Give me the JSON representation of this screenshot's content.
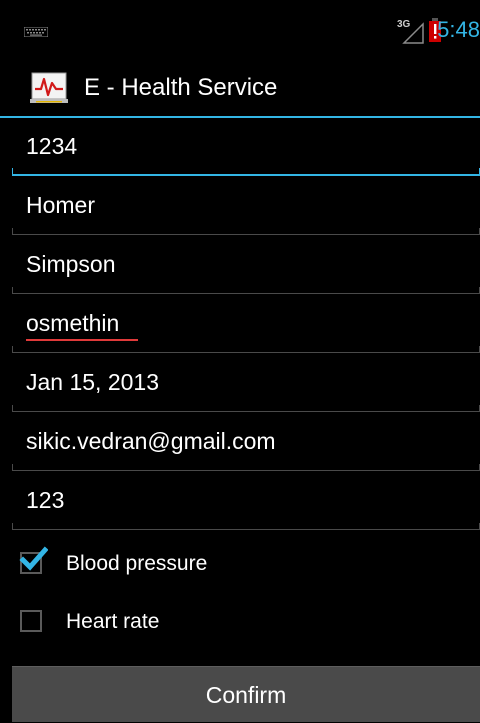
{
  "status_bar": {
    "network_label": "3G",
    "time": "5:48",
    "accent_color": "#33b5e5"
  },
  "action_bar": {
    "title": "E - Health Service",
    "icon": "heart-monitor-icon"
  },
  "form": {
    "fields": [
      {
        "value": "1234"
      },
      {
        "value": "Homer"
      },
      {
        "value": "Simpson"
      },
      {
        "value": "osmethin"
      },
      {
        "value": "Jan 15, 2013"
      },
      {
        "value": "sikic.vedran@gmail.com"
      },
      {
        "value": "123"
      }
    ],
    "checkboxes": [
      {
        "label": "Blood pressure",
        "checked": true
      },
      {
        "label": "Heart rate",
        "checked": false
      }
    ],
    "confirm_label": "Confirm"
  }
}
